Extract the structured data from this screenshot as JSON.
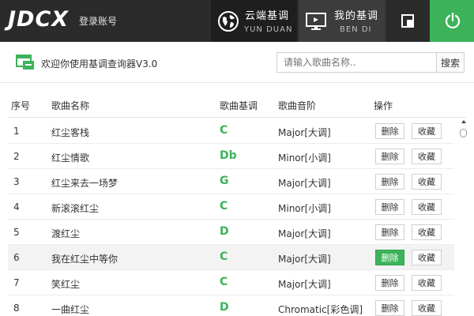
{
  "app": {
    "logo": "JDCX",
    "account_label": "登录账号"
  },
  "nav": {
    "cloud": {
      "title": "云端基调",
      "subtitle": "YUN DUAN",
      "icon": "globe-icon"
    },
    "local": {
      "title": "我的基调",
      "subtitle": "BEN DI",
      "icon": "monitor-icon"
    }
  },
  "welcome": {
    "text": "欢迎你使用基调查询器V3.0",
    "icon": "app-window-icon"
  },
  "search": {
    "placeholder": "请输入歌曲名称..",
    "button_label": "搜索"
  },
  "table": {
    "headers": {
      "no": "序号",
      "name": "歌曲名称",
      "key": "歌曲基调",
      "scale": "歌曲音阶",
      "action": "操作"
    },
    "delete_label": "删除",
    "favorite_label": "收藏",
    "rows": [
      {
        "no": "1",
        "name": "红尘客栈",
        "key": "C",
        "scale": "Major[大调]"
      },
      {
        "no": "2",
        "name": "红尘情歌",
        "key": "Db",
        "scale": "Minor[小调]"
      },
      {
        "no": "3",
        "name": "红尘来去一场梦",
        "key": "G",
        "scale": "Major[大调]"
      },
      {
        "no": "4",
        "name": "新滚滚红尘",
        "key": "C",
        "scale": "Minor[小调]"
      },
      {
        "no": "5",
        "name": "渡红尘",
        "key": "D",
        "scale": "Major[大调]"
      },
      {
        "no": "6",
        "name": "我在红尘中等你",
        "key": "C",
        "scale": "Major[大调]"
      },
      {
        "no": "7",
        "name": "笑红尘",
        "key": "C",
        "scale": "Major[大调]"
      },
      {
        "no": "8",
        "name": "一曲红尘",
        "key": "D",
        "scale": "Chromatic[彩色调]"
      }
    ]
  },
  "colors": {
    "accent": "#3cb35a",
    "topbar": "#2b2b2b"
  }
}
